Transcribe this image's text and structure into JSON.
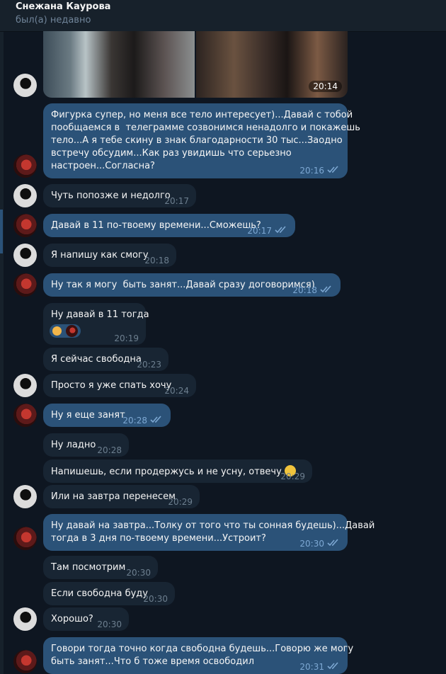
{
  "header": {
    "name": "Снежана Каурова",
    "status": "был(а) недавно"
  },
  "photo_time": "20:14",
  "icons": {
    "read_checks": "double-check-icon",
    "smile": "smiling-face-emoji",
    "reaction": "ok-hand-reaction"
  },
  "colors": {
    "incoming": "#182533",
    "outgoing": "#2b5278",
    "background": "#0e1621"
  },
  "messages": [
    {
      "from": "me",
      "text": "Фигурка супер, но меня все тело интересует)...Давай с тобой\nпообщаемся в  телеграмме созвонимся ненадолго и покажешь\nтело...А я тебе скину в знак благодарности 30 тыс...Заодно\nвстречу обсудим...Как раз увидишь что серьезно\nнастроен...Согласна?",
      "time": "20:16"
    },
    {
      "from": "her",
      "text": "Чуть попозже и недолго",
      "time": "20:17"
    },
    {
      "from": "me",
      "text": "Давай в 11 по-твоему времени...Сможешь?",
      "time": "20:17"
    },
    {
      "from": "her",
      "text": "Я напишу как смогу",
      "time": "20:18"
    },
    {
      "from": "me",
      "text": "Ну так я могу  быть занят...Давай сразу договоримся)",
      "time": "20:18"
    },
    {
      "from": "her",
      "text": "Ну давай в 11 тогда",
      "time": "20:19"
    },
    {
      "from": "her",
      "text": "Я сейчас свободна",
      "time": "20:23"
    },
    {
      "from": "her",
      "text": "Просто я уже спать хочу",
      "time": "20:24"
    },
    {
      "from": "me",
      "text": "Ну я еще занят",
      "time": "20:28"
    },
    {
      "from": "her",
      "text": "Ну ладно",
      "time": "20:28"
    },
    {
      "from": "her",
      "text": "Напишешь, если продержусь и не усну, отвечу",
      "time": "20:29"
    },
    {
      "from": "her",
      "text": "Или на завтра перенесем",
      "time": "20:29"
    },
    {
      "from": "me",
      "text": "Ну давай на завтра...Толку от того что ты сонная будешь)...Давай\nтогда в 3 дня по-твоему времени...Устроит?",
      "time": "20:30"
    },
    {
      "from": "her",
      "text": "Там посмотрим",
      "time": "20:30"
    },
    {
      "from": "her",
      "text": "Если свободна буду",
      "time": "20:30"
    },
    {
      "from": "her",
      "text": "Хорошо?",
      "time": "20:30"
    },
    {
      "from": "me",
      "text": "Говори тогда точно когда свободна будешь...Говорю же могу\nбыть занят...Что б тоже время освободил",
      "time": "20:31"
    }
  ]
}
